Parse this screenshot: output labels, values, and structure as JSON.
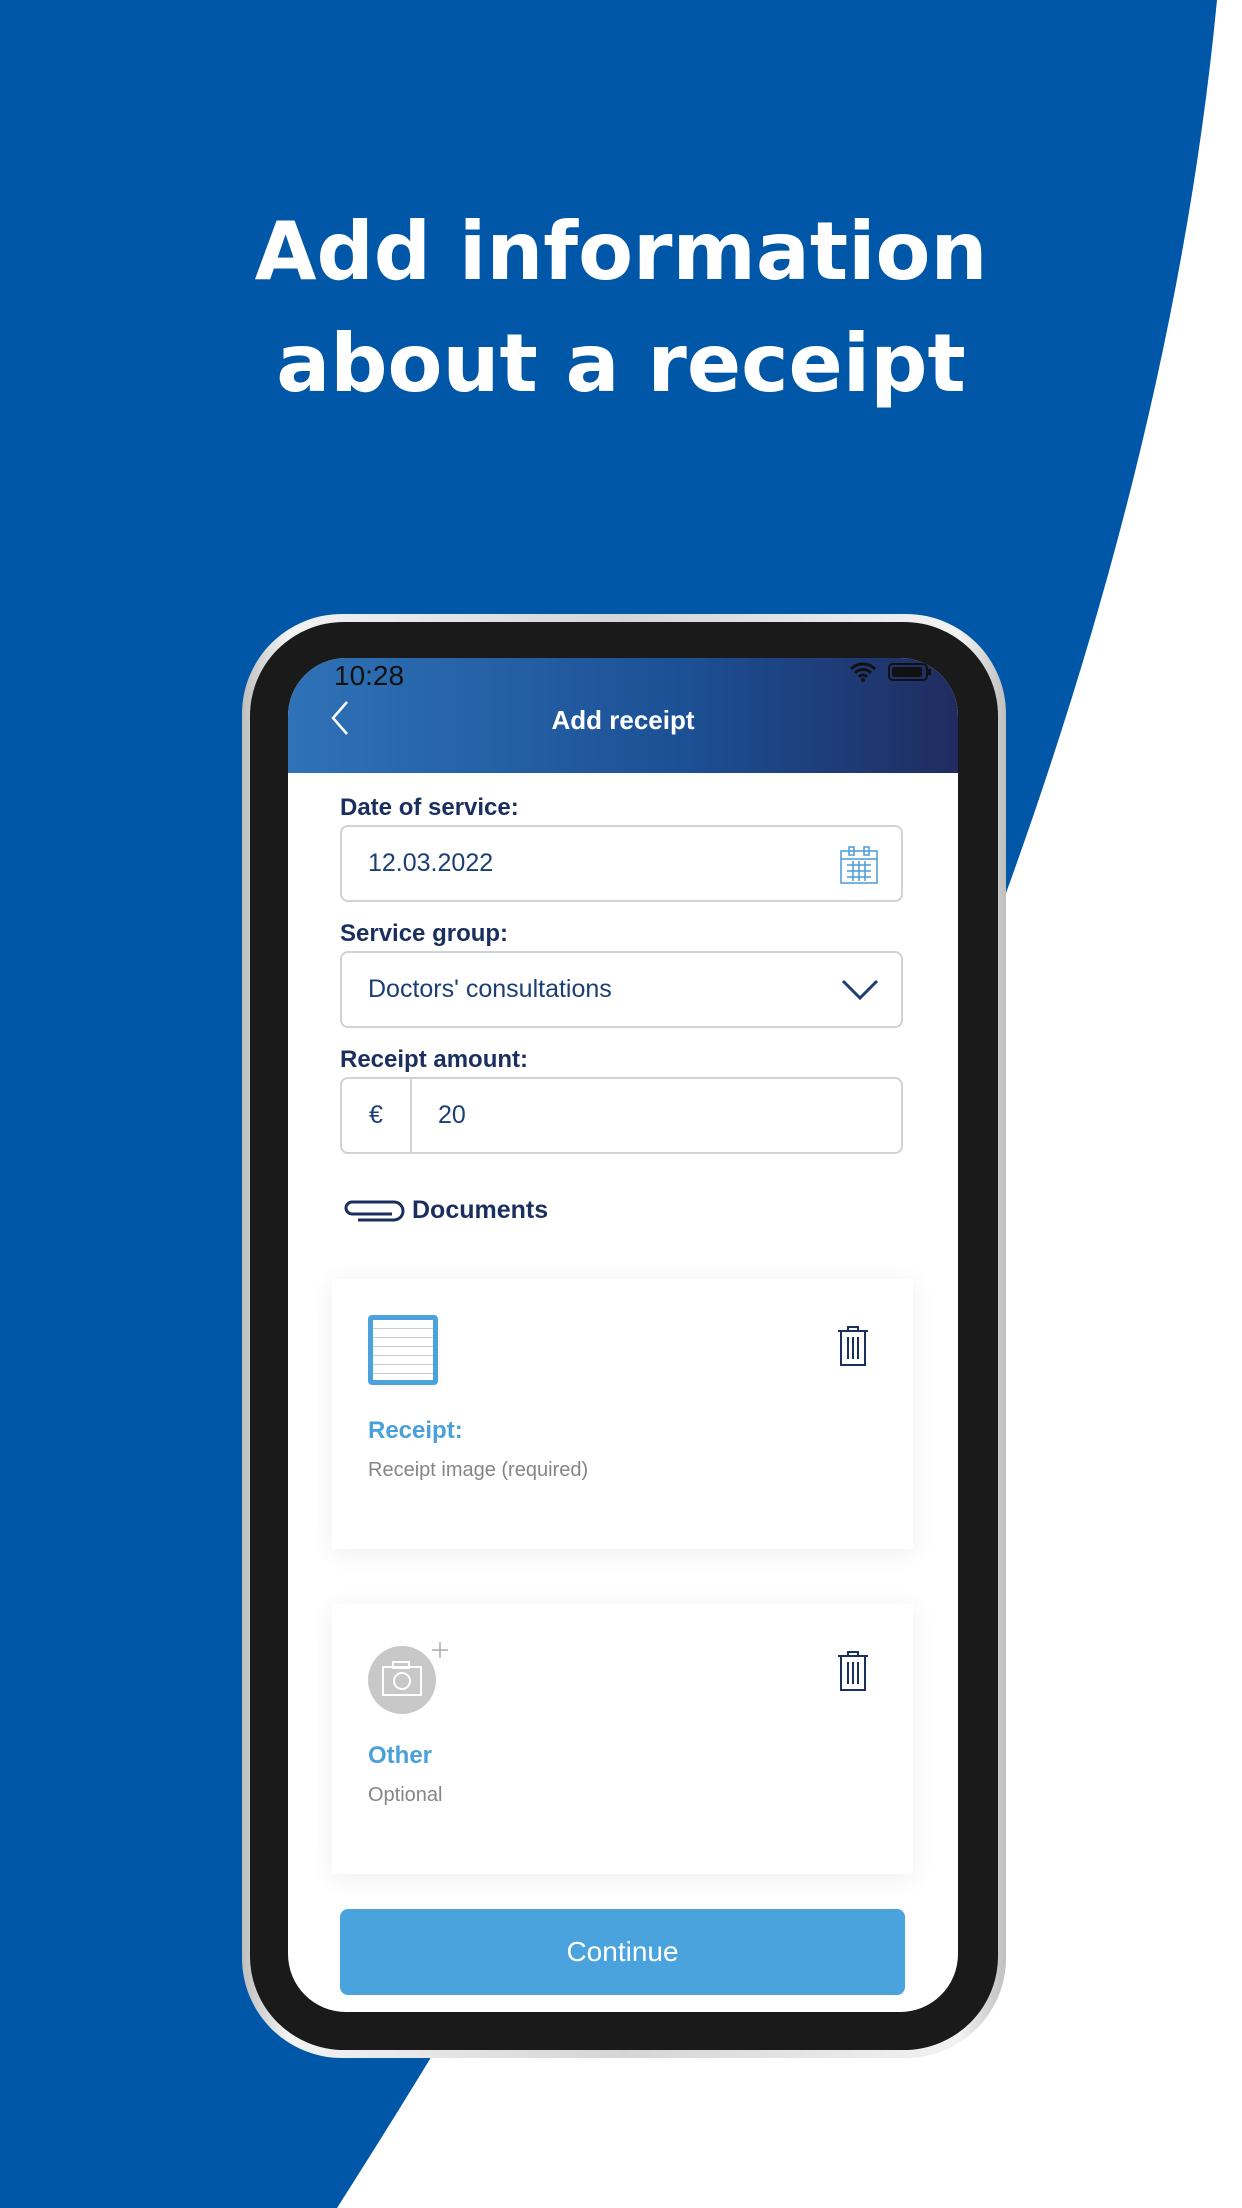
{
  "headline": {
    "line1": "Add information",
    "line2": "about a receipt"
  },
  "colors": {
    "brand_blue": "#0057a8",
    "accent": "#4aa3dc",
    "text_dark": "#1b2f5e"
  },
  "status_bar": {
    "time": "10:28",
    "icons": [
      "wifi-icon",
      "battery-icon"
    ]
  },
  "header": {
    "title": "Add receipt",
    "back_icon": "chevron-left-icon"
  },
  "form": {
    "date": {
      "label": "Date of service:",
      "value": "12.03.2022",
      "icon": "calendar-icon"
    },
    "service_group": {
      "label": "Service group:",
      "value": "Doctors' consultations",
      "icon": "chevron-down-icon"
    },
    "amount": {
      "label": "Receipt amount:",
      "currency": "€",
      "value": "20"
    }
  },
  "documents": {
    "title": "Documents",
    "icon": "paperclip-icon",
    "items": [
      {
        "title": "Receipt:",
        "subtitle": "Receipt image (required)"
      },
      {
        "title": "Other",
        "subtitle": "Optional"
      }
    ]
  },
  "continue_label": "Continue"
}
